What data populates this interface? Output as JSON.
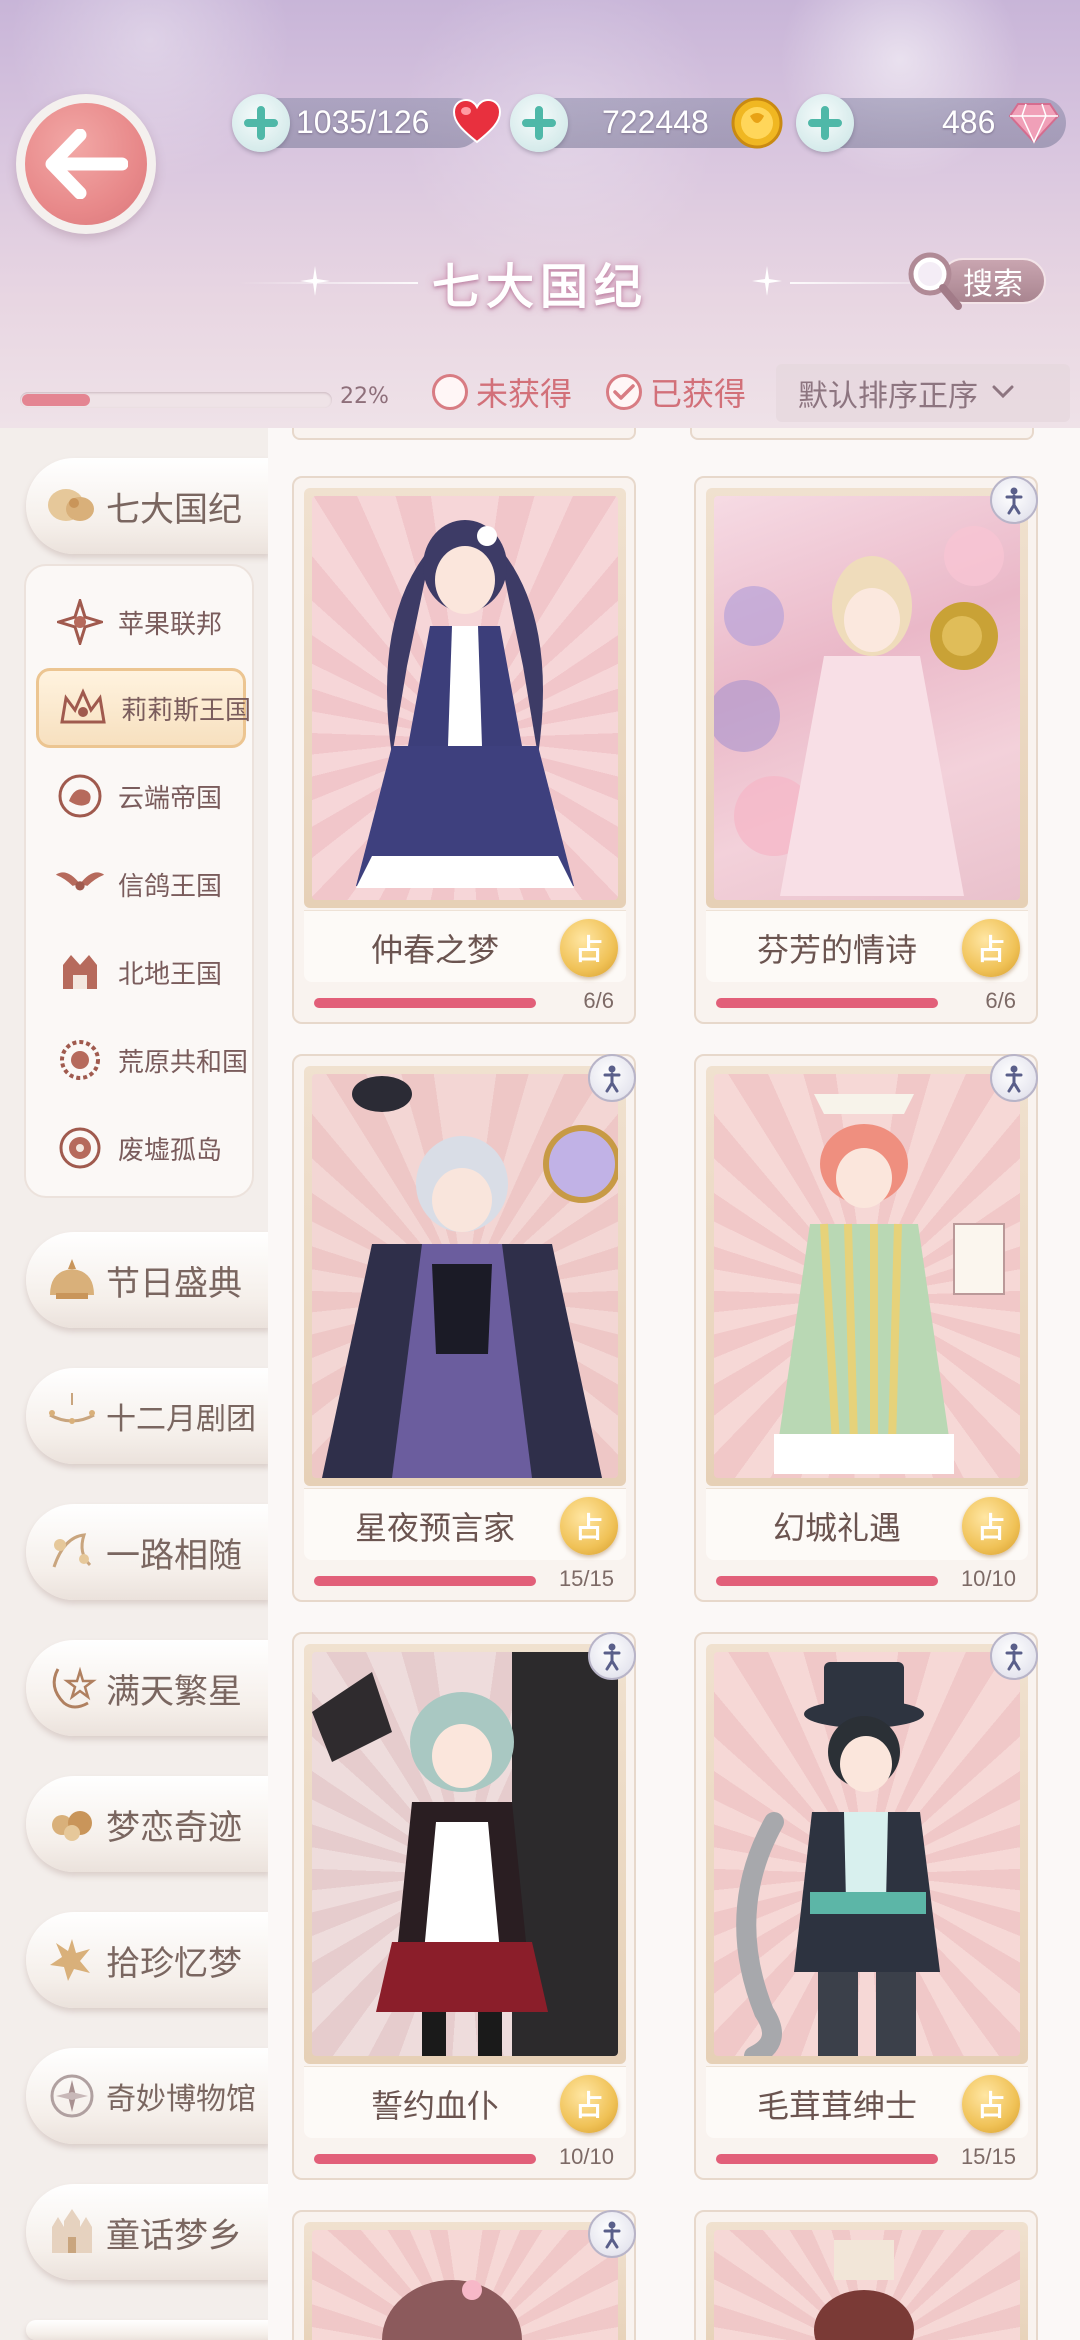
{
  "header": {
    "resources": [
      {
        "value": "1035/126",
        "icon": "heart-icon",
        "color": "#e8303e"
      },
      {
        "value": "722448",
        "icon": "gold-coin-icon",
        "color": "#f0b722"
      },
      {
        "value": "486",
        "icon": "pink-diamond-icon",
        "color": "#e88aa6"
      }
    ],
    "title": "七大国纪",
    "search_label": "搜索",
    "progress_percent": 22,
    "progress_label": "22%",
    "filters": [
      {
        "label": "未获得",
        "checked": false
      },
      {
        "label": "已获得",
        "checked": true
      }
    ],
    "sort_label": "默认排序正序"
  },
  "sidebar": {
    "categories": [
      {
        "label": "七大国纪",
        "icon": "seven-kingdoms-icon",
        "selected": true
      },
      {
        "label": "节日盛典",
        "icon": "festival-icon"
      },
      {
        "label": "十二月剧团",
        "icon": "chandelier-icon"
      },
      {
        "label": "一路相随",
        "icon": "companion-icon"
      },
      {
        "label": "满天繁星",
        "icon": "star-icon"
      },
      {
        "label": "梦恋奇迹",
        "icon": "dream-icon"
      },
      {
        "label": "拾珍忆梦",
        "icon": "memory-icon"
      },
      {
        "label": "奇妙博物馆",
        "icon": "compass-icon"
      },
      {
        "label": "童话梦乡",
        "icon": "castle-icon"
      }
    ],
    "kingdoms": [
      {
        "label": "苹果联邦",
        "icon": "apple-federation-icon"
      },
      {
        "label": "莉莉斯王国",
        "icon": "lilith-kingdom-icon",
        "active": true
      },
      {
        "label": "云端帝国",
        "icon": "cloud-empire-icon"
      },
      {
        "label": "信鸽王国",
        "icon": "pigeon-kingdom-icon"
      },
      {
        "label": "北地王国",
        "icon": "north-kingdom-icon"
      },
      {
        "label": "荒原共和国",
        "icon": "wasteland-republic-icon"
      },
      {
        "label": "废墟孤岛",
        "icon": "ruins-island-icon"
      }
    ]
  },
  "suits": [
    {
      "name": "仲春之梦",
      "collected": 6,
      "total": 6,
      "count_label": "6/6",
      "button": "占",
      "badge": false
    },
    {
      "name": "芬芳的情诗",
      "collected": 6,
      "total": 6,
      "count_label": "6/6",
      "button": "占",
      "badge": true
    },
    {
      "name": "星夜预言家",
      "collected": 15,
      "total": 15,
      "count_label": "15/15",
      "button": "占",
      "badge": true
    },
    {
      "name": "幻城礼遇",
      "collected": 10,
      "total": 10,
      "count_label": "10/10",
      "button": "占",
      "badge": true
    },
    {
      "name": "誓约血仆",
      "collected": 10,
      "total": 10,
      "count_label": "10/10",
      "button": "占",
      "badge": true
    },
    {
      "name": "毛茸茸绅士",
      "collected": 15,
      "total": 15,
      "count_label": "15/15",
      "button": "占",
      "badge": true
    }
  ]
}
